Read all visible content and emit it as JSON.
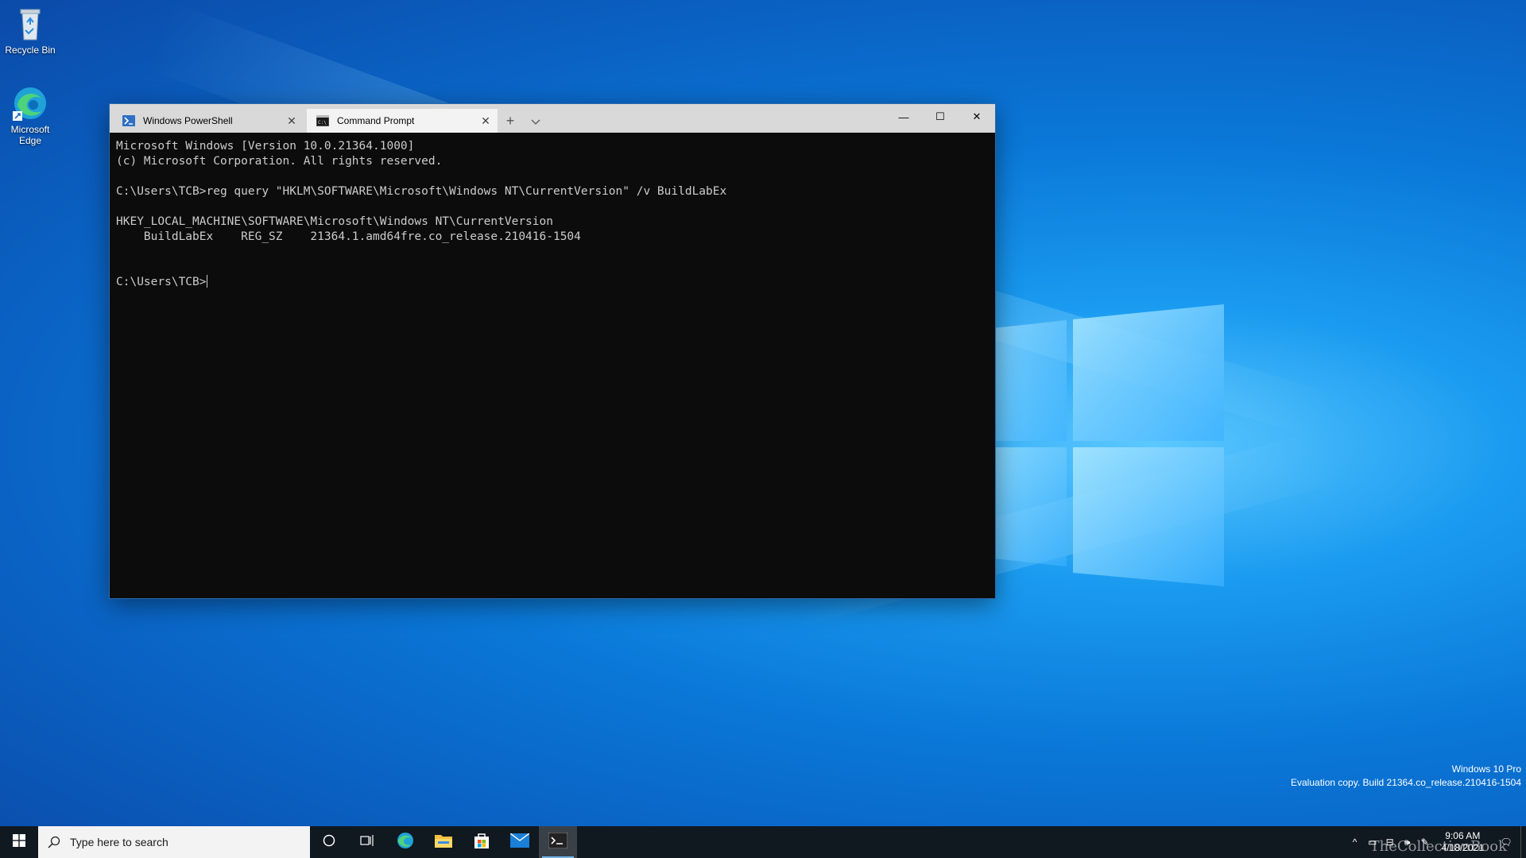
{
  "desktop": {
    "icons": [
      {
        "label": "Recycle Bin",
        "icon": "recycle-bin-icon"
      },
      {
        "label": "Microsoft Edge",
        "icon": "edge-icon"
      }
    ],
    "watermark": {
      "line1": "Windows 10 Pro",
      "line2": "Evaluation copy. Build 21364.co_release.210416-1504"
    }
  },
  "terminal": {
    "tabs": [
      {
        "label": "Windows PowerShell",
        "icon": "powershell-icon",
        "active": false
      },
      {
        "label": "Command Prompt",
        "icon": "cmd-icon",
        "active": true
      }
    ],
    "console_lines": [
      "Microsoft Windows [Version 10.0.21364.1000]",
      "(c) Microsoft Corporation. All rights reserved.",
      "",
      "C:\\Users\\TCB>reg query \"HKLM\\SOFTWARE\\Microsoft\\Windows NT\\CurrentVersion\" /v BuildLabEx",
      "",
      "HKEY_LOCAL_MACHINE\\SOFTWARE\\Microsoft\\Windows NT\\CurrentVersion",
      "    BuildLabEx    REG_SZ    21364.1.amd64fre.co_release.210416-1504",
      "",
      ""
    ],
    "prompt": "C:\\Users\\TCB>"
  },
  "taskbar": {
    "search_placeholder": "Type here to search",
    "pinned": [
      {
        "name": "cortana-icon"
      },
      {
        "name": "task-view-icon"
      },
      {
        "name": "edge-icon"
      },
      {
        "name": "file-explorer-icon"
      },
      {
        "name": "store-icon"
      },
      {
        "name": "mail-icon"
      },
      {
        "name": "terminal-icon",
        "active": true
      }
    ],
    "clock": {
      "time": "9:06 AM",
      "date": "4/18/2021"
    },
    "brand_watermark": "TheCollectionBook"
  }
}
